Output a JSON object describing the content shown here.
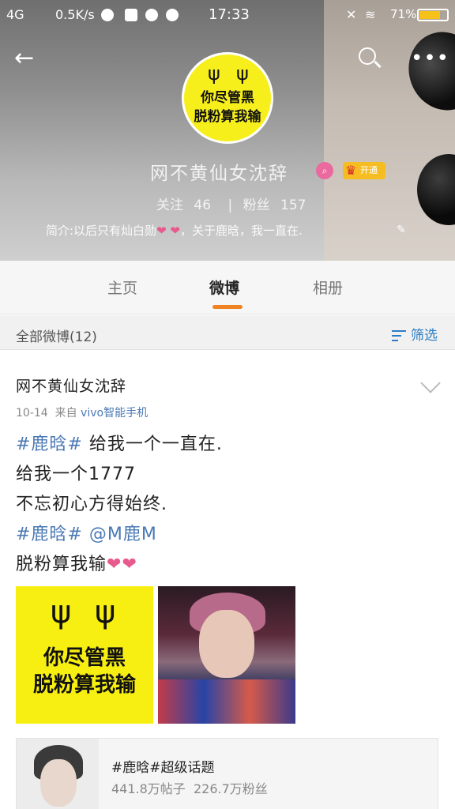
{
  "status_bar": {
    "network": "4G",
    "speed": "0.5K/s",
    "time": "17:33",
    "battery": "71%"
  },
  "profile": {
    "avatar_line1": "你尽管黑",
    "avatar_line2": "脱粉算我输",
    "nickname": "网不黄仙女沈辞",
    "vip_label": "开通",
    "following_label": "关注",
    "following_count": "46",
    "followers_label": "粉丝",
    "followers_count": "157",
    "intro_text": "简介:以后只有灿白勋",
    "intro_tail": "，关于鹿晗，我一直在."
  },
  "tabs": {
    "home": "主页",
    "weibo": "微博",
    "album": "相册"
  },
  "filter": {
    "all_posts": "全部微博(12)",
    "filter_label": "筛选"
  },
  "post": {
    "author": "网不黄仙女沈辞",
    "date": "10-14",
    "from_label": "来自",
    "source": "vivo智能手机",
    "line1_tag": "#鹿晗#",
    "line1_text": "给我一个一直在.",
    "line2": "给我一个1777",
    "line3": "不忘初心方得始终.",
    "line4_tag": "#鹿晗#",
    "line4_mention": "@M鹿M",
    "line5": "脱粉算我输",
    "image1_line1": "你尽管黑",
    "image1_line2": "脱粉算我输"
  },
  "topic_card": {
    "title": "#鹿晗#超级话题",
    "posts": "441.8万帖子",
    "fans": "226.7万粉丝"
  },
  "colors": {
    "accent_orange": "#f08321",
    "link_blue": "#4b79b5",
    "heart_pink": "#e85a8e",
    "avatar_yellow": "#f7ef1c"
  }
}
